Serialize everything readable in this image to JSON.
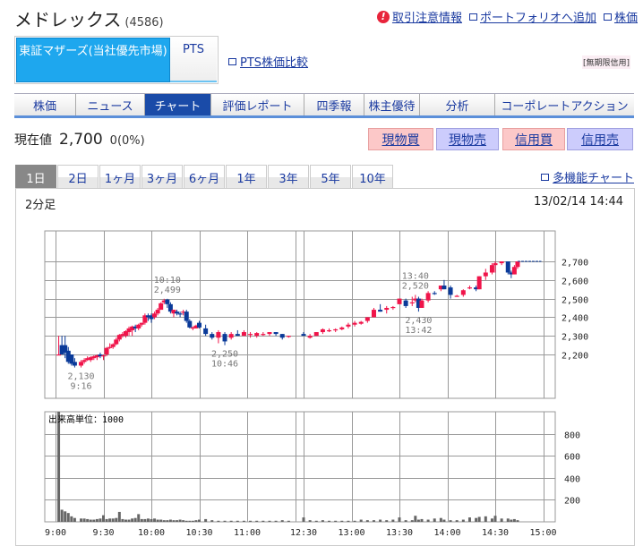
{
  "header": {
    "name": "メドレックス",
    "code": "(4586)",
    "links": [
      "取引注意情報",
      "ポートフォリオへ追加",
      "株価"
    ]
  },
  "market_tabs": [
    "東証マザーズ(当社優先市場)",
    "PTS"
  ],
  "pts_compare": "PTS株価比較",
  "credit_badge": "[無期限信用]",
  "nav_tabs": [
    "株価",
    "ニュース",
    "チャート",
    "評価レポート",
    "四季報",
    "株主優待",
    "分析",
    "コーポレートアクション"
  ],
  "nav_active": "チャート",
  "quote": {
    "label": "現在値",
    "price": "2,700",
    "change": "0(0%)"
  },
  "trade_buttons": [
    "現物買",
    "現物売",
    "信用買",
    "信用売"
  ],
  "period_tabs": [
    "1日",
    "2日",
    "1ヶ月",
    "3ヶ月",
    "6ヶ月",
    "1年",
    "3年",
    "5年",
    "10年"
  ],
  "period_active": "1日",
  "multi_chart": "多機能チャート",
  "colors": {
    "up": "#f0144a",
    "down": "#0a3a99",
    "grid": "#999999",
    "accent": "#1ea7ee",
    "nav_active": "#1a4ba8"
  },
  "chart_data": {
    "type": "candlestick",
    "interval_label": "2分足",
    "timestamp": "13/02/14 14:44",
    "price_ticks": [
      "2,700",
      "2,600",
      "2,500",
      "2,400",
      "2,300",
      "2,200"
    ],
    "price_tick_values": [
      2700,
      2600,
      2500,
      2400,
      2300,
      2200
    ],
    "volume_unit_label": "出来高単位：1000",
    "volume_ticks": [
      800,
      600,
      400,
      200
    ],
    "x_ticks": [
      "9:00",
      "9:30",
      "10:00",
      "10:30",
      "11:00",
      "12:30",
      "13:00",
      "13:30",
      "14:00",
      "14:30",
      "15:00"
    ],
    "annotations": [
      {
        "time": "10:10",
        "price": 2499,
        "text1": "10:10",
        "text2": "2,499",
        "pos": "above"
      },
      {
        "time": "9:16",
        "price": 2130,
        "text1": "2,130",
        "text2": "9:16",
        "pos": "below"
      },
      {
        "time": "10:46",
        "price": 2250,
        "text1": "2,250",
        "text2": "10:46",
        "pos": "below"
      },
      {
        "time": "13:40",
        "price": 2520,
        "text1": "13:40",
        "text2": "2,520",
        "pos": "above"
      },
      {
        "time": "13:42",
        "price": 2430,
        "text1": "2,430",
        "text2": "13:42",
        "pos": "below"
      }
    ],
    "candles_cols": [
      "time",
      "open",
      "high",
      "low",
      "close",
      "volume"
    ],
    "candles": [
      [
        "9:02",
        2200,
        2300,
        2200,
        2200,
        1000
      ],
      [
        "9:04",
        2250,
        2300,
        2200,
        2200,
        110
      ],
      [
        "9:06",
        2250,
        2300,
        2180,
        2210,
        95
      ],
      [
        "9:08",
        2220,
        2240,
        2150,
        2160,
        80
      ],
      [
        "9:10",
        2200,
        2200,
        2140,
        2150,
        50
      ],
      [
        "9:12",
        2160,
        2180,
        2130,
        2140,
        35
      ],
      [
        "9:16",
        2140,
        2170,
        2130,
        2160,
        30
      ],
      [
        "9:18",
        2160,
        2180,
        2150,
        2170,
        30
      ],
      [
        "9:20",
        2170,
        2190,
        2165,
        2180,
        25
      ],
      [
        "9:22",
        2170,
        2190,
        2160,
        2185,
        20
      ],
      [
        "9:24",
        2180,
        2195,
        2170,
        2190,
        20
      ],
      [
        "9:26",
        2185,
        2200,
        2170,
        2195,
        25
      ],
      [
        "9:28",
        2200,
        2210,
        2180,
        2190,
        30
      ],
      [
        "9:30",
        2190,
        2200,
        2170,
        2195,
        60
      ],
      [
        "9:32",
        2200,
        2240,
        2190,
        2235,
        25
      ],
      [
        "9:34",
        2240,
        2260,
        2230,
        2240,
        30
      ],
      [
        "9:36",
        2240,
        2260,
        2230,
        2255,
        30
      ],
      [
        "9:38",
        2255,
        2290,
        2250,
        2280,
        35
      ],
      [
        "9:40",
        2280,
        2310,
        2270,
        2305,
        90
      ],
      [
        "9:42",
        2300,
        2320,
        2290,
        2310,
        25
      ],
      [
        "9:44",
        2300,
        2330,
        2290,
        2325,
        20
      ],
      [
        "9:46",
        2320,
        2350,
        2300,
        2340,
        20
      ],
      [
        "9:48",
        2330,
        2355,
        2300,
        2350,
        30
      ],
      [
        "9:50",
        2350,
        2360,
        2320,
        2340,
        35
      ],
      [
        "9:52",
        2340,
        2365,
        2330,
        2360,
        70
      ],
      [
        "9:54",
        2360,
        2370,
        2350,
        2370,
        25
      ],
      [
        "9:56",
        2370,
        2420,
        2360,
        2410,
        25
      ],
      [
        "9:58",
        2410,
        2420,
        2380,
        2400,
        30
      ],
      [
        "10:00",
        2410,
        2420,
        2370,
        2390,
        25
      ],
      [
        "10:02",
        2400,
        2430,
        2390,
        2420,
        30
      ],
      [
        "10:04",
        2420,
        2450,
        2410,
        2440,
        20
      ],
      [
        "10:06",
        2440,
        2480,
        2440,
        2475,
        20
      ],
      [
        "10:08",
        2480,
        2499,
        2470,
        2490,
        15
      ],
      [
        "10:10",
        2495,
        2499,
        2450,
        2470,
        15
      ],
      [
        "10:12",
        2470,
        2480,
        2420,
        2430,
        20
      ],
      [
        "10:14",
        2420,
        2440,
        2400,
        2440,
        15
      ],
      [
        "10:16",
        2430,
        2440,
        2410,
        2420,
        15
      ],
      [
        "10:18",
        2420,
        2430,
        2400,
        2415,
        20
      ],
      [
        "10:20",
        2430,
        2440,
        2410,
        2430,
        15
      ],
      [
        "10:22",
        2430,
        2440,
        2370,
        2380,
        10
      ],
      [
        "10:24",
        2380,
        2390,
        2340,
        2345,
        10
      ],
      [
        "10:26",
        2340,
        2350,
        2330,
        2345,
        10
      ],
      [
        "10:28",
        2340,
        2360,
        2340,
        2355,
        15
      ],
      [
        "10:30",
        2370,
        2380,
        2340,
        2345,
        20
      ],
      [
        "10:34",
        2340,
        2360,
        2300,
        2310,
        25
      ],
      [
        "10:38",
        2310,
        2320,
        2280,
        2290,
        15
      ],
      [
        "10:42",
        2290,
        2330,
        2260,
        2320,
        10
      ],
      [
        "10:46",
        2310,
        2320,
        2250,
        2270,
        10
      ],
      [
        "10:50",
        2290,
        2320,
        2280,
        2310,
        10
      ],
      [
        "10:54",
        2310,
        2330,
        2300,
        2300,
        10
      ],
      [
        "10:58",
        2300,
        2330,
        2300,
        2320,
        10
      ],
      [
        "11:02",
        2310,
        2320,
        2290,
        2310,
        10
      ],
      [
        "11:06",
        2300,
        2320,
        2290,
        2315,
        10
      ],
      [
        "11:10",
        2310,
        2320,
        2300,
        2310,
        10
      ],
      [
        "11:14",
        2310,
        2320,
        2300,
        2320,
        10
      ],
      [
        "11:18",
        2320,
        2320,
        2300,
        2310,
        10
      ],
      [
        "11:22",
        2310,
        2310,
        2280,
        2290,
        15
      ],
      [
        "11:26",
        2300,
        2300,
        2290,
        2300,
        10
      ],
      [
        "12:30",
        2310,
        2320,
        2300,
        2300,
        40
      ],
      [
        "12:34",
        2290,
        2310,
        2285,
        2300,
        15
      ],
      [
        "12:38",
        2300,
        2320,
        2300,
        2320,
        10
      ],
      [
        "12:42",
        2320,
        2340,
        2310,
        2335,
        15
      ],
      [
        "12:46",
        2330,
        2340,
        2320,
        2330,
        10
      ],
      [
        "12:50",
        2330,
        2340,
        2320,
        2335,
        10
      ],
      [
        "12:54",
        2335,
        2350,
        2330,
        2345,
        10
      ],
      [
        "12:58",
        2350,
        2370,
        2340,
        2360,
        10
      ],
      [
        "13:02",
        2360,
        2380,
        2350,
        2370,
        10
      ],
      [
        "13:06",
        2365,
        2380,
        2360,
        2375,
        20
      ],
      [
        "13:10",
        2380,
        2400,
        2370,
        2400,
        15
      ],
      [
        "13:14",
        2400,
        2450,
        2400,
        2440,
        15
      ],
      [
        "13:18",
        2440,
        2470,
        2430,
        2430,
        20
      ],
      [
        "13:22",
        2440,
        2460,
        2420,
        2450,
        15
      ],
      [
        "13:26",
        2450,
        2460,
        2440,
        2455,
        20
      ],
      [
        "13:30",
        2470,
        2500,
        2470,
        2500,
        40
      ],
      [
        "13:34",
        2490,
        2500,
        2450,
        2460,
        15
      ],
      [
        "13:38",
        2480,
        2510,
        2460,
        2480,
        15
      ],
      [
        "13:40",
        2490,
        2520,
        2480,
        2500,
        55
      ],
      [
        "13:42",
        2500,
        2510,
        2430,
        2450,
        20
      ],
      [
        "13:44",
        2450,
        2500,
        2450,
        2490,
        25
      ],
      [
        "13:48",
        2490,
        2540,
        2480,
        2530,
        20
      ],
      [
        "13:52",
        2530,
        2540,
        2520,
        2525,
        30
      ],
      [
        "13:56",
        2550,
        2570,
        2540,
        2570,
        35
      ],
      [
        "13:58",
        2570,
        2600,
        2550,
        2550,
        20
      ],
      [
        "14:02",
        2560,
        2570,
        2500,
        2520,
        15
      ],
      [
        "14:06",
        2510,
        2520,
        2510,
        2515,
        15
      ],
      [
        "14:10",
        2520,
        2550,
        2510,
        2545,
        20
      ],
      [
        "14:14",
        2560,
        2570,
        2550,
        2560,
        40
      ],
      [
        "14:18",
        2560,
        2570,
        2540,
        2550,
        35
      ],
      [
        "14:20",
        2550,
        2620,
        2550,
        2620,
        45
      ],
      [
        "14:24",
        2620,
        2660,
        2600,
        2640,
        50
      ],
      [
        "14:28",
        2640,
        2690,
        2630,
        2680,
        30
      ],
      [
        "14:30",
        2680,
        2700,
        2640,
        2690,
        55
      ],
      [
        "14:34",
        2690,
        2700,
        2680,
        2700,
        30
      ],
      [
        "14:38",
        2700,
        2700,
        2630,
        2640,
        30
      ],
      [
        "14:40",
        2640,
        2650,
        2610,
        2630,
        20
      ],
      [
        "14:42",
        2630,
        2680,
        2630,
        2670,
        25
      ],
      [
        "14:44",
        2670,
        2700,
        2660,
        2700,
        15
      ]
    ]
  }
}
